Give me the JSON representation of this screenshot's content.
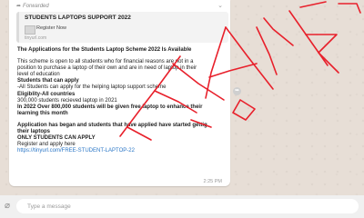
{
  "message": {
    "forwarded_label": "Forwarded",
    "preview": {
      "title": "STUDENTS LAPTOPS SUPPORT 2022",
      "thumb_label": "Register Now",
      "domain": "tinyurl.com"
    },
    "lines": {
      "heading": "The Applications for the Students Laptop Scheme 2022 Is Available",
      "para1_a": "This scheme is open to all students who for financial reasons are not in a",
      "para1_b": "position to purchase a laptop of their own and are in need of laptop in their",
      "para1_c": "level of education",
      "who_heading": "Students that can apply",
      "who_text": "-All Students can apply for the helping laptop support scheme",
      "elig_heading": "Eligiblity-All countries",
      "elig_text": "300,000 students recieved laptop in 2021",
      "bold_a": "In 2022 Over 800,000 students will be given free laptop to enhance their",
      "bold_b": "learning this month",
      "app_a": "Application has began and students that have applied have started gettig",
      "app_b": "their laptops",
      "only": "ONLY STUDENTS CAN APPLY",
      "register": "Register and apply here",
      "link": "https://tinyurl.com/FREE-STUDENT-LAPTOP-22"
    },
    "time": "2:25 PM"
  },
  "composer": {
    "placeholder": "Type a message"
  },
  "icons": {
    "attach": "paperclip-icon",
    "share": "share-icon",
    "chevron": "chevron-down-icon"
  },
  "colors": {
    "scrawl": "#e8202b",
    "link": "#2a76c6",
    "bubble": "#ffffff",
    "chat_bg": "#e7ded6"
  }
}
